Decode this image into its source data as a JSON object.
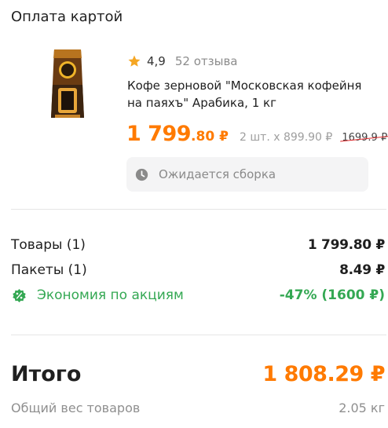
{
  "header": {
    "title": "Оплата картой"
  },
  "product": {
    "image_icon": "coffee-package",
    "rating": "4,9",
    "reviews": "52 отзыва",
    "name": "Кофе зерновой \"Московская кофейня на паяхъ\" Арабика, 1 кг",
    "price_main": "1 799",
    "price_cents": ".80",
    "currency": "₽",
    "unit_price": "2 шт. х 899.90 ₽",
    "old_price": "1699.9 ₽",
    "status_icon": "clock-icon",
    "status": "Ожидается сборка"
  },
  "summary": {
    "goods_label": "Товары (1)",
    "goods_value": "1 799.80 ₽",
    "packages_label": "Пакеты (1)",
    "packages_value": "8.49 ₽",
    "discount_icon": "percent-badge-icon",
    "discount_label": "Экономия по акциям",
    "discount_value": "-47% (1600 ₽)"
  },
  "total": {
    "label": "Итого",
    "value": "1 808.29 ₽",
    "weight_label": "Общий вес товаров",
    "weight_value": "2.05 кг"
  },
  "colors": {
    "accent": "#ff7a00",
    "success": "#34a853",
    "strike": "#e0282a",
    "star": "#f5a623"
  }
}
